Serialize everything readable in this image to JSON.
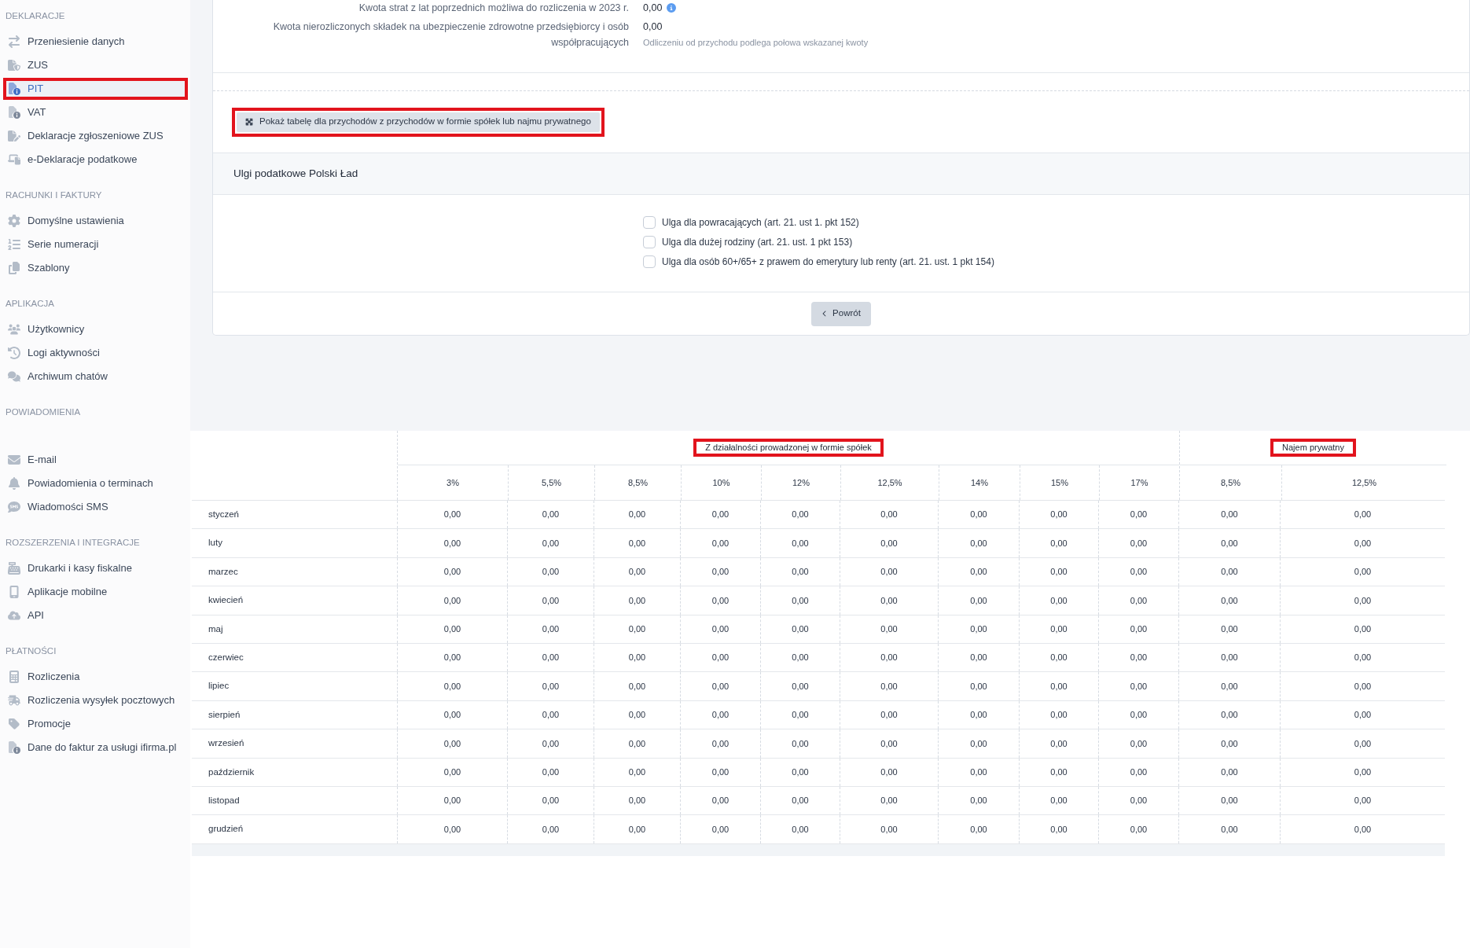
{
  "sidebar": {
    "sections": [
      {
        "title": "DEKLARACJE",
        "items": [
          {
            "label": "Przeniesienie danych",
            "selected": false,
            "annotated": false
          },
          {
            "label": "ZUS",
            "selected": false,
            "annotated": false
          },
          {
            "label": "PIT",
            "selected": true,
            "annotated": true
          },
          {
            "label": "VAT",
            "selected": false,
            "annotated": false
          },
          {
            "label": "Deklaracje zgłoszeniowe ZUS",
            "selected": false,
            "annotated": false
          },
          {
            "label": "e-Deklaracje podatkowe",
            "selected": false,
            "annotated": false
          }
        ]
      },
      {
        "title": "RACHUNKI I FAKTURY",
        "items": [
          {
            "label": "Domyślne ustawienia",
            "selected": false,
            "annotated": false
          },
          {
            "label": "Serie numeracji",
            "selected": false,
            "annotated": false
          },
          {
            "label": "Szablony",
            "selected": false,
            "annotated": false
          }
        ]
      },
      {
        "title": "APLIKACJA",
        "items": [
          {
            "label": "Użytkownicy",
            "selected": false,
            "annotated": false
          },
          {
            "label": "Logi aktywności",
            "selected": false,
            "annotated": false
          },
          {
            "label": "Archiwum chatów",
            "selected": false,
            "annotated": false
          }
        ]
      },
      {
        "title": "POWIADOMIENIA",
        "items": [
          {
            "label": "E-mail",
            "selected": false,
            "annotated": false
          },
          {
            "label": "Powiadomienia o terminach",
            "selected": false,
            "annotated": false
          },
          {
            "label": "Wiadomości SMS",
            "selected": false,
            "annotated": false
          }
        ]
      },
      {
        "title": "ROZSZERZENIA I INTEGRACJE",
        "items": [
          {
            "label": "Drukarki i kasy fiskalne",
            "selected": false,
            "annotated": false
          },
          {
            "label": "Aplikacje mobilne",
            "selected": false,
            "annotated": false
          },
          {
            "label": "API",
            "selected": false,
            "annotated": false
          }
        ]
      },
      {
        "title": "PŁATNOŚCI",
        "items": [
          {
            "label": "Rozliczenia",
            "selected": false,
            "annotated": false
          },
          {
            "label": "Rozliczenia wysyłek pocztowych",
            "selected": false,
            "annotated": false
          },
          {
            "label": "Promocje",
            "selected": false,
            "annotated": false
          },
          {
            "label": "Dane do faktur za usługi ifirma.pl",
            "selected": false,
            "annotated": false
          }
        ]
      }
    ]
  },
  "form": {
    "rows": [
      {
        "label": "Kwota strat z lat poprzednich możliwa do rozliczenia w 2023 r.",
        "value": "0,00",
        "info": true
      },
      {
        "label": "Kwota nierozliczonych składek na ubezpieczenie zdrowotne przedsiębiorcy i osób współpracujących",
        "value": "0,00",
        "hint": "Odliczeniu od przychodu podlega połowa wskazanej kwoty",
        "info": false
      }
    ]
  },
  "table_toggle": {
    "label": "Pokaż tabelę dla przychodów z przychodów w formie spółek lub najmu prywatnego",
    "annotated": true
  },
  "tax_reliefs": {
    "title": "Ulgi podatkowe Polski Ład",
    "options": [
      {
        "label": "Ulga dla powracających (art. 21. ust 1. pkt 152)",
        "checked": false
      },
      {
        "label": "Ulga dla dużej rodziny (art. 21. ust. 1 pkt 153)",
        "checked": false
      },
      {
        "label": "Ulga dla osób 60+/65+ z prawem do emerytury lub renty (art. 21. ust. 1 pkt 154)",
        "checked": false
      }
    ]
  },
  "back_button": {
    "label": "Powrót"
  },
  "table": {
    "column_groups": [
      {
        "label": "Z działalności prowadzonej w formie spółek",
        "annotated": true,
        "columns": [
          "3%",
          "5,5%",
          "8,5%",
          "10%",
          "12%",
          "12,5%",
          "14%",
          "15%",
          "17%"
        ]
      },
      {
        "label": "Najem prywatny",
        "annotated": true,
        "columns": [
          "8,5%",
          "12,5%"
        ]
      }
    ],
    "rows": [
      {
        "label": "styczeń",
        "cells": [
          "0,00",
          "0,00",
          "0,00",
          "0,00",
          "0,00",
          "0,00",
          "0,00",
          "0,00",
          "0,00",
          "0,00",
          "0,00"
        ]
      },
      {
        "label": "luty",
        "cells": [
          "0,00",
          "0,00",
          "0,00",
          "0,00",
          "0,00",
          "0,00",
          "0,00",
          "0,00",
          "0,00",
          "0,00",
          "0,00"
        ]
      },
      {
        "label": "marzec",
        "cells": [
          "0,00",
          "0,00",
          "0,00",
          "0,00",
          "0,00",
          "0,00",
          "0,00",
          "0,00",
          "0,00",
          "0,00",
          "0,00"
        ]
      },
      {
        "label": "kwiecień",
        "cells": [
          "0,00",
          "0,00",
          "0,00",
          "0,00",
          "0,00",
          "0,00",
          "0,00",
          "0,00",
          "0,00",
          "0,00",
          "0,00"
        ]
      },
      {
        "label": "maj",
        "cells": [
          "0,00",
          "0,00",
          "0,00",
          "0,00",
          "0,00",
          "0,00",
          "0,00",
          "0,00",
          "0,00",
          "0,00",
          "0,00"
        ]
      },
      {
        "label": "czerwiec",
        "cells": [
          "0,00",
          "0,00",
          "0,00",
          "0,00",
          "0,00",
          "0,00",
          "0,00",
          "0,00",
          "0,00",
          "0,00",
          "0,00"
        ]
      },
      {
        "label": "lipiec",
        "cells": [
          "0,00",
          "0,00",
          "0,00",
          "0,00",
          "0,00",
          "0,00",
          "0,00",
          "0,00",
          "0,00",
          "0,00",
          "0,00"
        ]
      },
      {
        "label": "sierpień",
        "cells": [
          "0,00",
          "0,00",
          "0,00",
          "0,00",
          "0,00",
          "0,00",
          "0,00",
          "0,00",
          "0,00",
          "0,00",
          "0,00"
        ]
      },
      {
        "label": "wrzesień",
        "cells": [
          "0,00",
          "0,00",
          "0,00",
          "0,00",
          "0,00",
          "0,00",
          "0,00",
          "0,00",
          "0,00",
          "0,00",
          "0,00"
        ]
      },
      {
        "label": "październik",
        "cells": [
          "0,00",
          "0,00",
          "0,00",
          "0,00",
          "0,00",
          "0,00",
          "0,00",
          "0,00",
          "0,00",
          "0,00",
          "0,00"
        ]
      },
      {
        "label": "listopad",
        "cells": [
          "0,00",
          "0,00",
          "0,00",
          "0,00",
          "0,00",
          "0,00",
          "0,00",
          "0,00",
          "0,00",
          "0,00",
          "0,00"
        ]
      },
      {
        "label": "grudzień",
        "cells": [
          "0,00",
          "0,00",
          "0,00",
          "0,00",
          "0,00",
          "0,00",
          "0,00",
          "0,00",
          "0,00",
          "0,00",
          "0,00"
        ]
      }
    ]
  }
}
